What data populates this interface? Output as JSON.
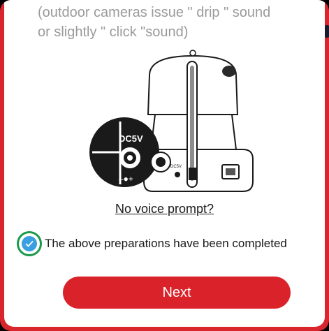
{
  "instruction": {
    "text": "(outdoor cameras issue \" drip \" sound\nor slightly \" click \"sound)"
  },
  "illustration": {
    "port_label": "DC5V",
    "polarity_label": "–●+",
    "small_port_label": "DC5V"
  },
  "voice_prompt": {
    "label": "No voice prompt?"
  },
  "preparation": {
    "label": "The above preparations have been completed",
    "checked": true
  },
  "next_button": {
    "label": "Next"
  },
  "colors": {
    "accent": "#d9222a",
    "checkbox": "#3a9fe0",
    "highlight_ring": "#1a9a4a",
    "instruction_text": "#9a9a9a"
  }
}
